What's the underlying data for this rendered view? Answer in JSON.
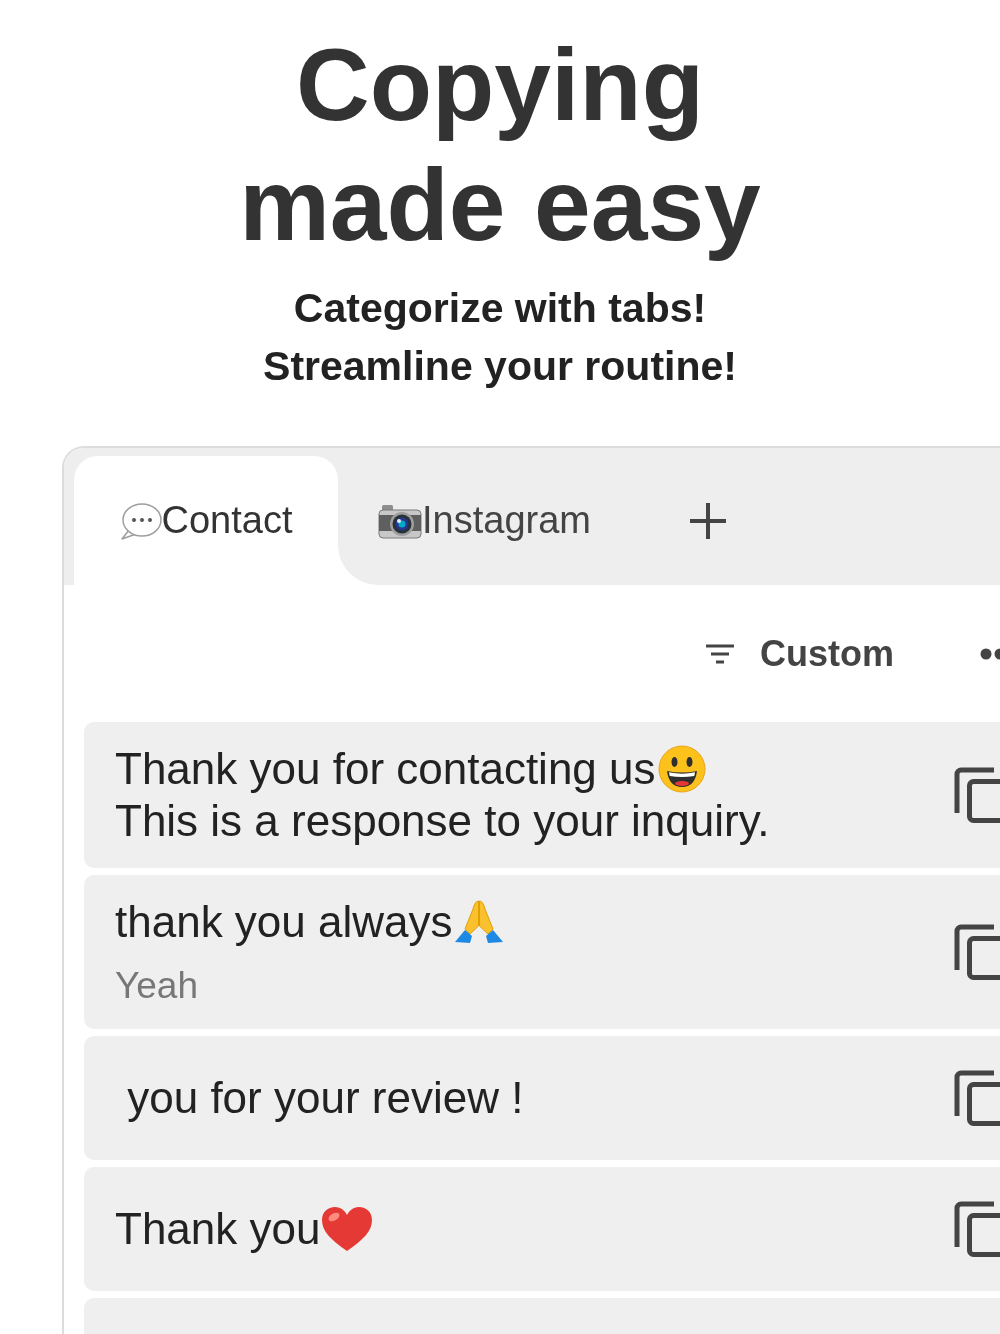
{
  "header": {
    "title": "Copying made easy",
    "subtitle_lines": [
      "Categorize with tabs!",
      "Streamline your routine!"
    ]
  },
  "tabs": [
    {
      "label": "Contact",
      "kind": "speech-bubble",
      "selected": true
    },
    {
      "label": "Instagram",
      "kind": "camera",
      "selected": false
    }
  ],
  "toolbar": {
    "sort_label": "Custom"
  },
  "snippets": [
    {
      "text": "Thank you for contacting us",
      "kind": "smiley",
      "body": "This is a response to your inquiry."
    },
    {
      "text": "thank you always",
      "kind": "praying-hands",
      "note": "Yeah"
    },
    {
      "text": " you for your review !",
      "kind": "plain"
    },
    {
      "text": "Thank you",
      "kind": "heart"
    }
  ]
}
